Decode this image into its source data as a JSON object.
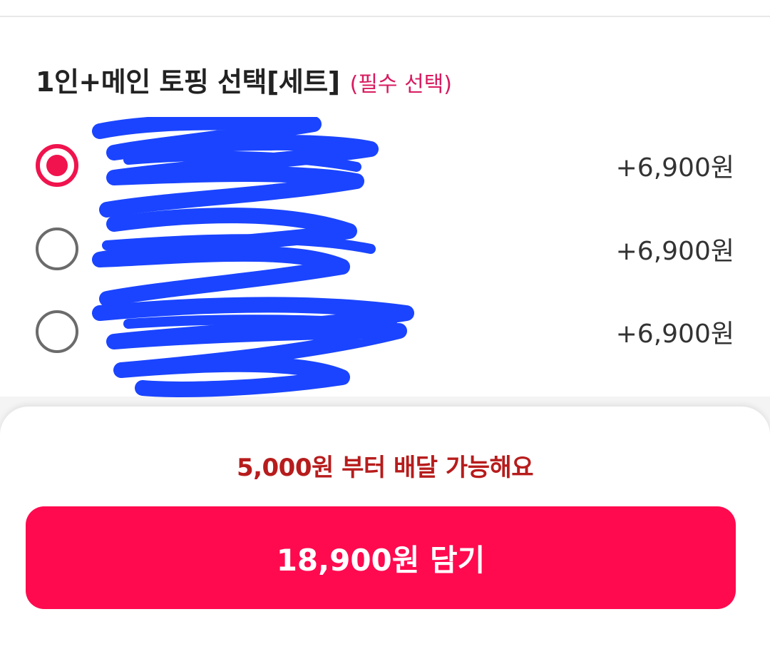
{
  "section": {
    "title": "1인+메인 토핑 선택[세트]",
    "required_badge": "(필수 선택)"
  },
  "options": [
    {
      "label": "",
      "price": "+6,900원",
      "selected": true
    },
    {
      "label": "",
      "price": "+6,900원",
      "selected": false
    },
    {
      "label": "",
      "price": "+6,900원",
      "selected": false
    }
  ],
  "footer": {
    "min_order_notice": "5,000원 부터 배달 가능해요",
    "add_button_label": "18,900원 담기"
  },
  "colors": {
    "accent": "#ff0a4f",
    "notice": "#b71c1c",
    "required": "#d81b60",
    "redaction": "#1a44ff"
  }
}
